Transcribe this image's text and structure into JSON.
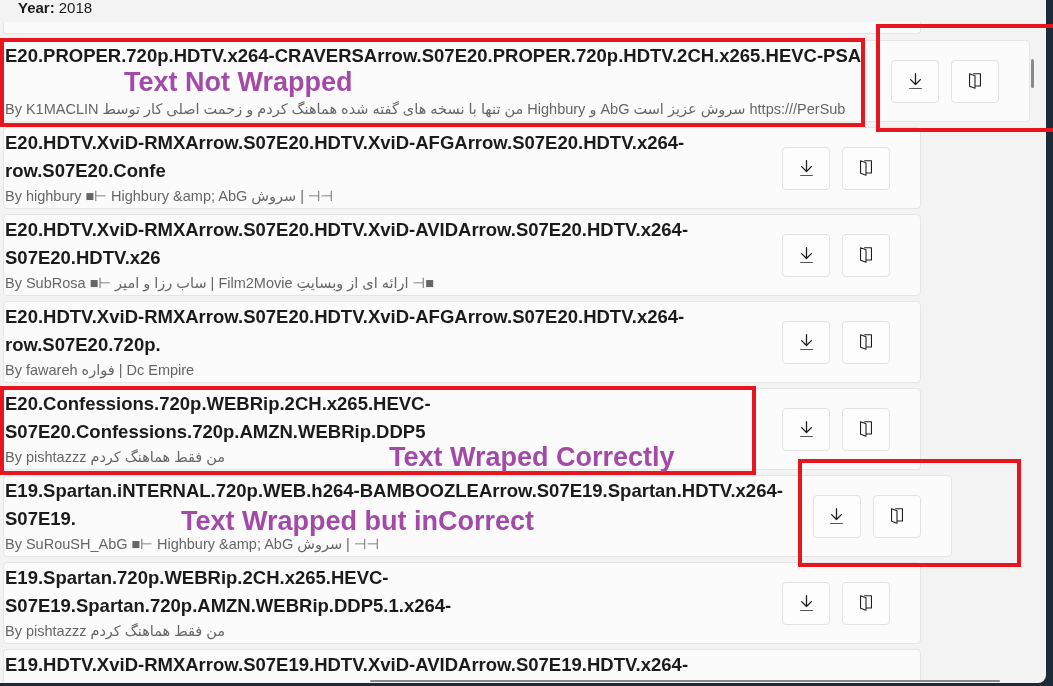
{
  "details": {
    "label": "Year:",
    "value": "2018"
  },
  "results": [
    {
      "title_lines": [
        "E20.PROPER.720p.HDTV.x264-CRAVERSArrow.S07E20.PROPER.720p.HDTV.2CH.x265.HEVC-PSA"
      ],
      "subtitle": "By K1MACLIN من تنها با نسخه های گفته شده هماهنگ کردم و زحمت اصلی کار توسط Highbury و AbG سروش عزیز است https:///PerSub",
      "actions": [
        {
          "kind": "download"
        },
        {
          "kind": "open"
        }
      ],
      "outline_text": true,
      "outline_actions": true,
      "note": {
        "text": "Text Not Wrapped",
        "kind": "gap"
      }
    },
    {
      "title_lines": [
        "E20.HDTV.XviD-RMXArrow.S07E20.HDTV.XviD-AFGArrow.S07E20.HDTV.x264-",
        "row.S07E20.Confe"
      ],
      "subtitle": "By highbury ■⊢ Highbury &amp; AbG سروش | ⊣⊣",
      "actions": [
        {
          "kind": "download"
        },
        {
          "kind": "open"
        }
      ],
      "outline_text": false,
      "outline_actions": false
    },
    {
      "title_lines": [
        "E20.HDTV.XviD-RMXArrow.S07E20.HDTV.XviD-AVIDArrow.S07E20.HDTV.x264-",
        "S07E20.HDTV.x26"
      ],
      "subtitle": "By SubRosa ■⊢ ساب رزا و امیر | Film2Movie ارائه ای از وبسایتِ ⊣■",
      "actions": [
        {
          "kind": "download"
        },
        {
          "kind": "open"
        }
      ],
      "outline_text": false,
      "outline_actions": false
    },
    {
      "title_lines": [
        "E20.HDTV.XviD-RMXArrow.S07E20.HDTV.XviD-AFGArrow.S07E20.HDTV.x264-",
        "row.S07E20.720p."
      ],
      "subtitle": "By fawareh فواره | Dc Empire",
      "actions": [
        {
          "kind": "download"
        },
        {
          "kind": "open"
        }
      ],
      "outline_text": false,
      "outline_actions": false
    },
    {
      "title_lines": [
        "E20.Confessions.720p.WEBRip.2CH.x265.HEVC-",
        "S07E20.Confessions.720p.AMZN.WEBRip.DDP5"
      ],
      "subtitle": "By pishtazzz من فقط هماهنگ کردم",
      "actions": [
        {
          "kind": "download"
        },
        {
          "kind": "open"
        }
      ],
      "outline_text": true,
      "outline_actions": false,
      "note": {
        "text": "Text Wraped Correctly",
        "kind": "end"
      }
    },
    {
      "title_lines": [
        "E19.Spartan.iNTERNAL.720p.WEB.h264-BAMBOOZLEArrow.S07E19.Spartan.HDTV.x264-",
        "S07E19."
      ],
      "subtitle": "By SuRouSH_AbG ■⊢ Highbury &amp; AbG سروش | ⊣⊣",
      "actions": [
        {
          "kind": "download"
        },
        {
          "kind": "open"
        }
      ],
      "outline_text": false,
      "outline_actions": true,
      "note": {
        "text": "Text Wrapped but inCorrect",
        "kind": "line2"
      }
    },
    {
      "title_lines": [
        "E19.Spartan.720p.WEBRip.2CH.x265.HEVC-",
        "S07E19.Spartan.720p.AMZN.WEBRip.DDP5.1.x264-"
      ],
      "subtitle": "By pishtazzz من فقط هماهنگ کردم",
      "actions": [
        {
          "kind": "download"
        },
        {
          "kind": "open"
        }
      ],
      "outline_text": false,
      "outline_actions": false
    },
    {
      "title_lines": [
        "E19.HDTV.XviD-RMXArrow.S07E19.HDTV.XviD-AVIDArrow.S07E19.HDTV.x264-"
      ],
      "outline_text": false,
      "outline_actions": false
    }
  ]
}
